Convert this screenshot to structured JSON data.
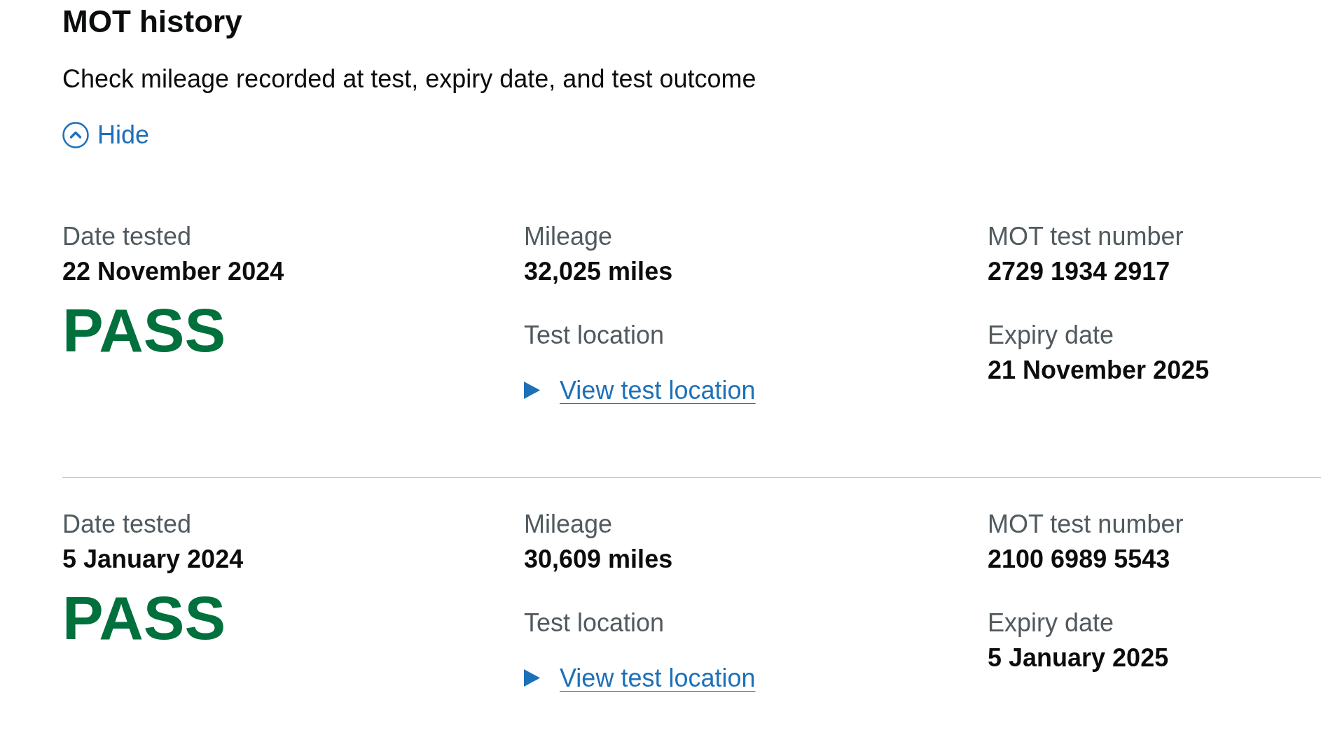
{
  "heading": "MOT history",
  "description": "Check mileage recorded at test, expiry date, and test outcome",
  "toggle": {
    "label": "Hide",
    "expanded": true
  },
  "tests": [
    {
      "date_tested": {
        "label": "Date tested",
        "value": "22 November 2024"
      },
      "result": "PASS",
      "mileage": {
        "label": "Mileage",
        "value": "32,025 miles"
      },
      "test_location": {
        "label": "Test location",
        "link": "View test location",
        "expanded": false
      },
      "test_number": {
        "label": "MOT test number",
        "value": "2729 1934 2917"
      },
      "expiry_date": {
        "label": "Expiry date",
        "value": "21 November 2025"
      }
    },
    {
      "date_tested": {
        "label": "Date tested",
        "value": "5 January 2024"
      },
      "result": "PASS",
      "mileage": {
        "label": "Mileage",
        "value": "30,609 miles"
      },
      "test_location": {
        "label": "Test location",
        "link": "View test location",
        "expanded": false
      },
      "test_number": {
        "label": "MOT test number",
        "value": "2100 6989 5543"
      },
      "expiry_date": {
        "label": "Expiry date",
        "value": "5 January 2025"
      }
    }
  ]
}
